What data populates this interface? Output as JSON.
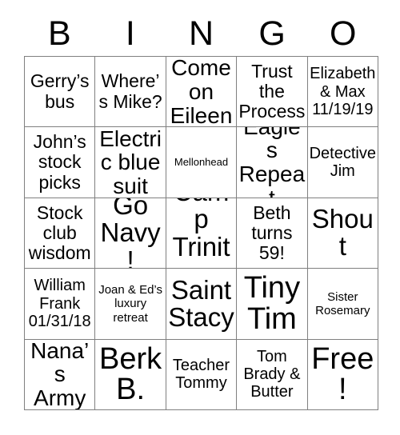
{
  "card": {
    "header_letters": [
      "B",
      "I",
      "N",
      "G",
      "O"
    ],
    "columns": 5,
    "rows": 5,
    "colors": {
      "text": "#000000",
      "background": "#ffffff",
      "grid_line": "#808080"
    },
    "cells": [
      {
        "text": "Gerry’s bus",
        "size": "lg"
      },
      {
        "text": "Where’s Mike?",
        "size": "lg"
      },
      {
        "text": "Come on Eileen",
        "size": "xl"
      },
      {
        "text": "Trust the Process",
        "size": "lg"
      },
      {
        "text": "Elizabeth & Max 11/19/19",
        "size": "md"
      },
      {
        "text": "John’s stock picks",
        "size": "lg"
      },
      {
        "text": "Electric blue suit",
        "size": "xl"
      },
      {
        "text": "Mellonhead",
        "size": "xs"
      },
      {
        "text": "Eagles Repeat",
        "size": "xl"
      },
      {
        "text": "Detective Jim",
        "size": "md"
      },
      {
        "text": "Stock club wisdom",
        "size": "lg"
      },
      {
        "text": "Go Navy!",
        "size": "xxl"
      },
      {
        "text": "Camp Trinity",
        "size": "xxl"
      },
      {
        "text": "Beth turns 59!",
        "size": "lg"
      },
      {
        "text": "Shout",
        "size": "xxl"
      },
      {
        "text": "William Frank 01/31/18",
        "size": "md"
      },
      {
        "text": "Joan & Ed’s luxury retreat",
        "size": "sm"
      },
      {
        "text": "Saint Stacy",
        "size": "xxl"
      },
      {
        "text": "Tiny Tim",
        "size": "huge"
      },
      {
        "text": "Sister Rosemary",
        "size": "sm"
      },
      {
        "text": "Nana’s Army",
        "size": "xl"
      },
      {
        "text": "Berk B.",
        "size": "huge"
      },
      {
        "text": "Teacher Tommy",
        "size": "md"
      },
      {
        "text": "Tom Brady & Butter",
        "size": "md"
      },
      {
        "text": "Free!",
        "size": "huge"
      }
    ]
  }
}
